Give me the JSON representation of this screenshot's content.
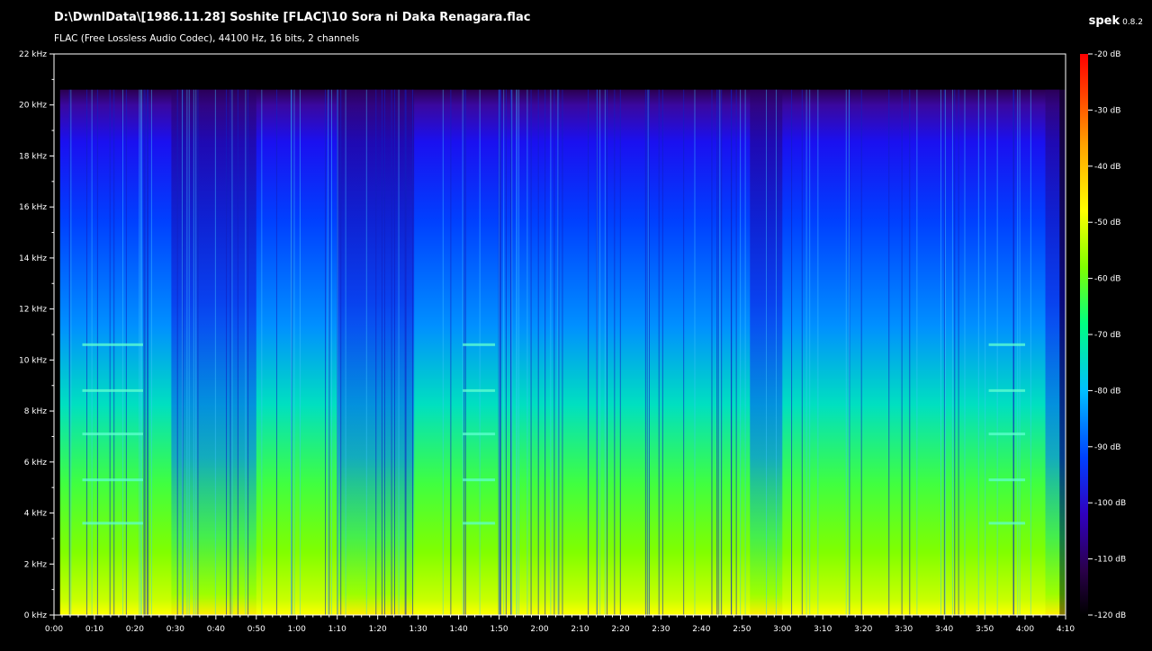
{
  "header": {
    "file_path": "D:\\DwnlData\\[1986.11.28] Soshite [FLAC]\\10 Sora ni Daka Renagara.flac",
    "file_info": "FLAC (Free Lossless Audio Codec), 44100 Hz, 16 bits, 2 channels",
    "app_name": "spek",
    "app_version": "0.8.2"
  },
  "chart_data": {
    "type": "heatmap",
    "title": "D:\\DwnlData\\[1986.11.28] Soshite [FLAC]\\10 Sora ni Daka Renagara.flac",
    "subtitle": "FLAC (Free Lossless Audio Codec), 44100 Hz, 16 bits, 2 channels",
    "xlabel": "",
    "ylabel": "",
    "x_unit": "seconds",
    "x_range": [
      0,
      250
    ],
    "y_unit": "kHz",
    "y_range": [
      0,
      22
    ],
    "x_ticks": [
      "0:00",
      "0:10",
      "0:20",
      "0:30",
      "0:40",
      "0:50",
      "1:00",
      "1:10",
      "1:20",
      "1:30",
      "1:40",
      "1:50",
      "2:00",
      "2:10",
      "2:20",
      "2:30",
      "2:40",
      "2:50",
      "3:00",
      "3:10",
      "3:20",
      "3:30",
      "3:40",
      "3:50",
      "4:00",
      "4:10"
    ],
    "y_ticks": [
      "0 kHz",
      "2 kHz",
      "4 kHz",
      "6 kHz",
      "8 kHz",
      "10 kHz",
      "12 kHz",
      "14 kHz",
      "16 kHz",
      "18 kHz",
      "20 kHz",
      "22 kHz"
    ],
    "colorbar": {
      "labels": [
        "-20 dB",
        "-30 dB",
        "-40 dB",
        "-50 dB",
        "-60 dB",
        "-70 dB",
        "-80 dB",
        "-90 dB",
        "-100 dB",
        "-110 dB",
        "-120 dB"
      ],
      "range_db": [
        -120,
        -20
      ],
      "colors": [
        "#000000",
        "#2a004a",
        "#3000c0",
        "#0040ff",
        "#00c0ff",
        "#00ff80",
        "#80ff00",
        "#ffff00",
        "#ffa000",
        "#ff4000",
        "#ff0000"
      ]
    },
    "content_cutoff_khz": 20.6,
    "quiet_regions_seconds": [
      [
        29,
        50
      ],
      [
        70,
        89
      ],
      [
        172,
        180
      ],
      [
        245,
        250
      ]
    ],
    "tone_marks_khz": [
      3.6,
      5.3,
      7.1,
      8.8,
      10.6
    ],
    "tone_mark_segments_seconds": [
      [
        7,
        22
      ],
      [
        101,
        109
      ],
      [
        231,
        240
      ]
    ]
  }
}
